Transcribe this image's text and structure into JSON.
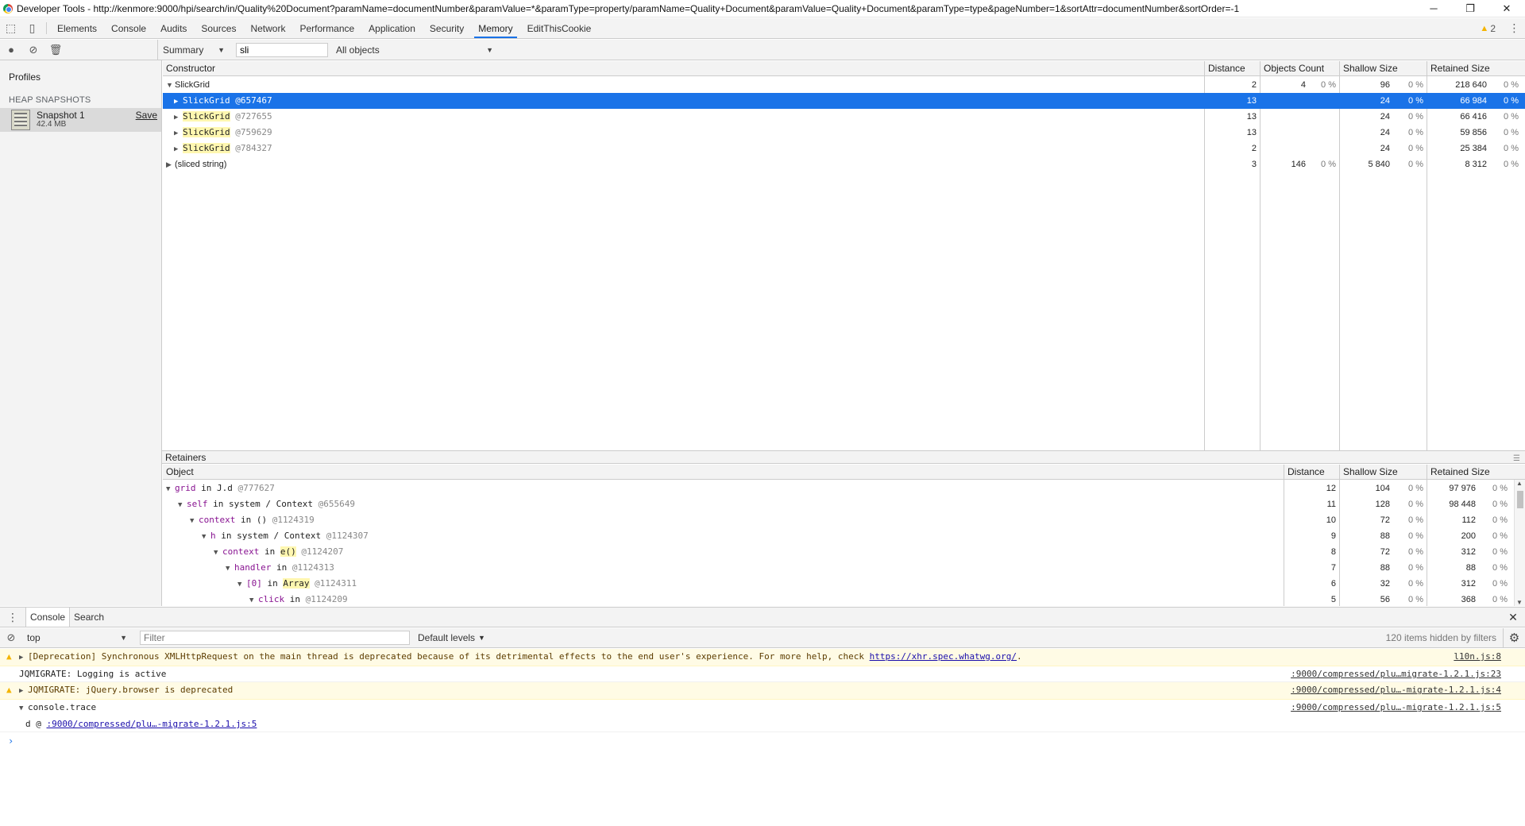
{
  "window": {
    "title": "Developer Tools - http://kenmore:9000/hpi/search/in/Quality%20Document?paramName=documentNumber&paramValue=*&paramType=property/paramName=Quality+Document&paramValue=Quality+Document&paramType=type&pageNumber=1&sortAttr=documentNumber&sortOrder=-1",
    "min": "─",
    "max": "❐",
    "close": "✕"
  },
  "tabs": [
    "Elements",
    "Console",
    "Audits",
    "Sources",
    "Network",
    "Performance",
    "Application",
    "Security",
    "Memory",
    "EditThisCookie"
  ],
  "active_tab": "Memory",
  "warnings_count": "2",
  "memory_toolbar": {
    "view_select": "Summary",
    "class_filter": "sli",
    "objects_select": "All objects"
  },
  "sidebar": {
    "title": "Profiles",
    "section": "HEAP SNAPSHOTS",
    "snapshot_name": "Snapshot 1",
    "snapshot_size": "42.4 MB",
    "save_label": "Save"
  },
  "constructor_table": {
    "headers": [
      "Constructor",
      "Distance",
      "Objects Count",
      "Shallow Size",
      "Retained Size"
    ],
    "rows": [
      {
        "name": "SlickGrid",
        "id": "",
        "distance": "2",
        "count": "4",
        "count_pct": "0 %",
        "shallow": "96",
        "shallow_pct": "0 %",
        "retained": "218 640",
        "retained_pct": "0 %"
      },
      {
        "name": "SlickGrid",
        "id": "@657467",
        "distance": "13",
        "count": "",
        "count_pct": "",
        "shallow": "24",
        "shallow_pct": "0 %",
        "retained": "66 984",
        "retained_pct": "0 %"
      },
      {
        "name": "SlickGrid",
        "id": "@727655",
        "distance": "13",
        "count": "",
        "count_pct": "",
        "shallow": "24",
        "shallow_pct": "0 %",
        "retained": "66 416",
        "retained_pct": "0 %"
      },
      {
        "name": "SlickGrid",
        "id": "@759629",
        "distance": "13",
        "count": "",
        "count_pct": "",
        "shallow": "24",
        "shallow_pct": "0 %",
        "retained": "59 856",
        "retained_pct": "0 %"
      },
      {
        "name": "SlickGrid",
        "id": "@784327",
        "distance": "2",
        "count": "",
        "count_pct": "",
        "shallow": "24",
        "shallow_pct": "0 %",
        "retained": "25 384",
        "retained_pct": "0 %"
      },
      {
        "name": "(sliced string)",
        "id": "",
        "distance": "3",
        "count": "146",
        "count_pct": "0 %",
        "shallow": "5 840",
        "shallow_pct": "0 %",
        "retained": "8 312",
        "retained_pct": "0 %"
      }
    ]
  },
  "retainers": {
    "label": "Retainers",
    "headers": [
      "Object",
      "Distance",
      "Shallow Size",
      "Retained Size"
    ],
    "rows": [
      {
        "prop": "grid",
        "mid": "in",
        "type": "J.d",
        "id": "@777627",
        "distance": "12",
        "shallow": "104",
        "shallow_pct": "0 %",
        "retained": "97 976",
        "retained_pct": "0 %"
      },
      {
        "prop": "self",
        "mid": "in",
        "type": "system / Context",
        "id": "@655649",
        "distance": "11",
        "shallow": "128",
        "shallow_pct": "0 %",
        "retained": "98 448",
        "retained_pct": "0 %"
      },
      {
        "prop": "context",
        "mid": "in",
        "type": "()",
        "id": "@1124319",
        "distance": "10",
        "shallow": "72",
        "shallow_pct": "0 %",
        "retained": "112",
        "retained_pct": "0 %"
      },
      {
        "prop": "h",
        "mid": "in",
        "type": "system / Context",
        "id": "@1124307",
        "distance": "9",
        "shallow": "88",
        "shallow_pct": "0 %",
        "retained": "200",
        "retained_pct": "0 %"
      },
      {
        "prop": "context",
        "mid": "in",
        "type": "e()",
        "id": "@1124207",
        "distance": "8",
        "shallow": "72",
        "shallow_pct": "0 %",
        "retained": "312",
        "retained_pct": "0 %"
      },
      {
        "prop": "handler",
        "mid": "in",
        "type": "",
        "id": "@1124313",
        "distance": "7",
        "shallow": "88",
        "shallow_pct": "0 %",
        "retained": "88",
        "retained_pct": "0 %"
      },
      {
        "prop": "[0]",
        "mid": "in",
        "type": "Array",
        "id": "@1124311",
        "distance": "6",
        "shallow": "32",
        "shallow_pct": "0 %",
        "retained": "312",
        "retained_pct": "0 %"
      },
      {
        "prop": "click",
        "mid": "in",
        "type": "",
        "id": "@1124209",
        "distance": "5",
        "shallow": "56",
        "shallow_pct": "0 %",
        "retained": "368",
        "retained_pct": "0 %"
      }
    ]
  },
  "drawer": {
    "tabs": [
      "Console",
      "Search"
    ],
    "context": "top",
    "filter_placeholder": "Filter",
    "levels": "Default levels",
    "hidden": "120 items hidden by filters"
  },
  "console": {
    "msg1_text": "[Deprecation] Synchronous XMLHttpRequest on the main thread is deprecated because of its detrimental effects to the end user's experience. For more help, check ",
    "msg1_link": "https://xhr.spec.whatwg.org/",
    "msg1_end": ".",
    "msg1_src": "l10n.js:8",
    "msg2_text": "JQMIGRATE: Logging is active",
    "msg2_src": ":9000/compressed/plu…migrate-1.2.1.js:23",
    "msg3_text": "JQMIGRATE: jQuery.browser is deprecated",
    "msg3_src": ":9000/compressed/plu…-migrate-1.2.1.js:4",
    "msg4_text": "console.trace",
    "msg4_src": ":9000/compressed/plu…-migrate-1.2.1.js:5",
    "trace_prefix": "d @ ",
    "trace_link": ":9000/compressed/plu…-migrate-1.2.1.js:5",
    "prompt": "›"
  }
}
